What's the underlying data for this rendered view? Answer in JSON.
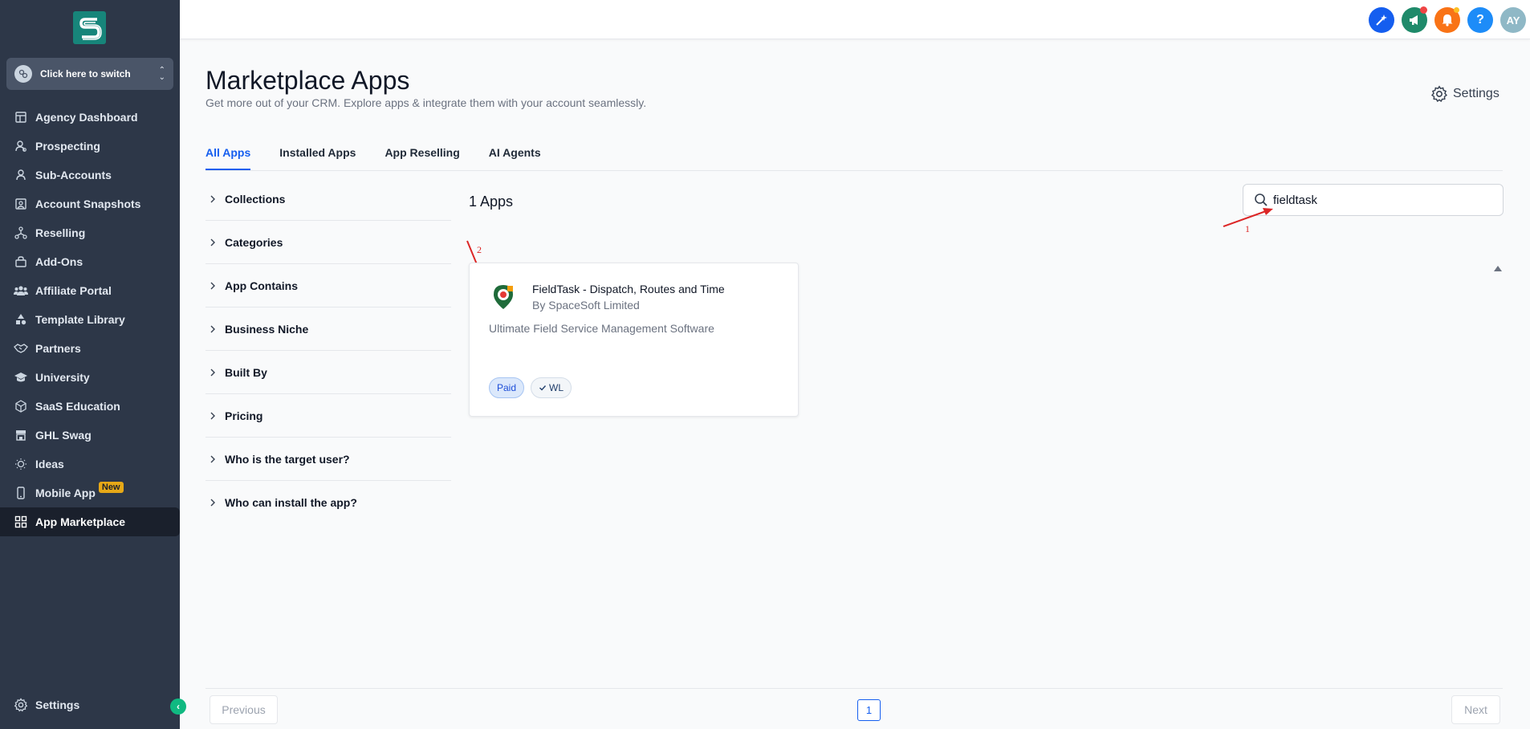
{
  "sidebar": {
    "switcher_label": "Click here to switch",
    "items": [
      {
        "label": "Agency Dashboard",
        "icon": "dashboard-icon"
      },
      {
        "label": "Prospecting",
        "icon": "prospecting-icon"
      },
      {
        "label": "Sub-Accounts",
        "icon": "user-icon"
      },
      {
        "label": "Account Snapshots",
        "icon": "snapshot-icon"
      },
      {
        "label": "Reselling",
        "icon": "reselling-icon"
      },
      {
        "label": "Add-Ons",
        "icon": "bag-icon"
      },
      {
        "label": "Affiliate Portal",
        "icon": "users-icon"
      },
      {
        "label": "Template Library",
        "icon": "shapes-icon"
      },
      {
        "label": "Partners",
        "icon": "handshake-icon"
      },
      {
        "label": "University",
        "icon": "graduation-cap-icon"
      },
      {
        "label": "SaaS Education",
        "icon": "cube-icon"
      },
      {
        "label": "GHL Swag",
        "icon": "store-icon"
      },
      {
        "label": "Ideas",
        "icon": "lightbulb-icon"
      },
      {
        "label": "Mobile App",
        "icon": "mobile-icon",
        "badge": "New"
      },
      {
        "label": "App Marketplace",
        "icon": "grid-icon",
        "active": true
      }
    ],
    "settings_label": "Settings"
  },
  "topbar": {
    "avatar_initials": "AY",
    "help_label": "?"
  },
  "header": {
    "title": "Marketplace Apps",
    "subtitle": "Get more out of your CRM. Explore apps & integrate them with your account seamlessly.",
    "settings_label": "Settings"
  },
  "tabs": [
    {
      "label": "All Apps",
      "active": true
    },
    {
      "label": "Installed Apps"
    },
    {
      "label": "App Reselling"
    },
    {
      "label": "AI Agents"
    }
  ],
  "filters": [
    "Collections",
    "Categories",
    "App Contains",
    "Business Niche",
    "Built By",
    "Pricing",
    "Who is the target user?",
    "Who can install the app?"
  ],
  "results": {
    "count_label": "1 Apps"
  },
  "search": {
    "value": "fieldtask"
  },
  "apps": [
    {
      "name": "FieldTask - Dispatch, Routes and Time",
      "by": "By SpaceSoft Limited",
      "description": "Ultimate Field Service Management Software",
      "tags": [
        "Paid",
        "WL"
      ]
    }
  ],
  "annotations": {
    "one": "1",
    "two": "2"
  },
  "pagination": {
    "previous": "Previous",
    "current": "1",
    "next": "Next"
  },
  "colors": {
    "sidebar_bg": "#2d3748",
    "accent": "#155eef",
    "annotation": "#dc2626"
  }
}
